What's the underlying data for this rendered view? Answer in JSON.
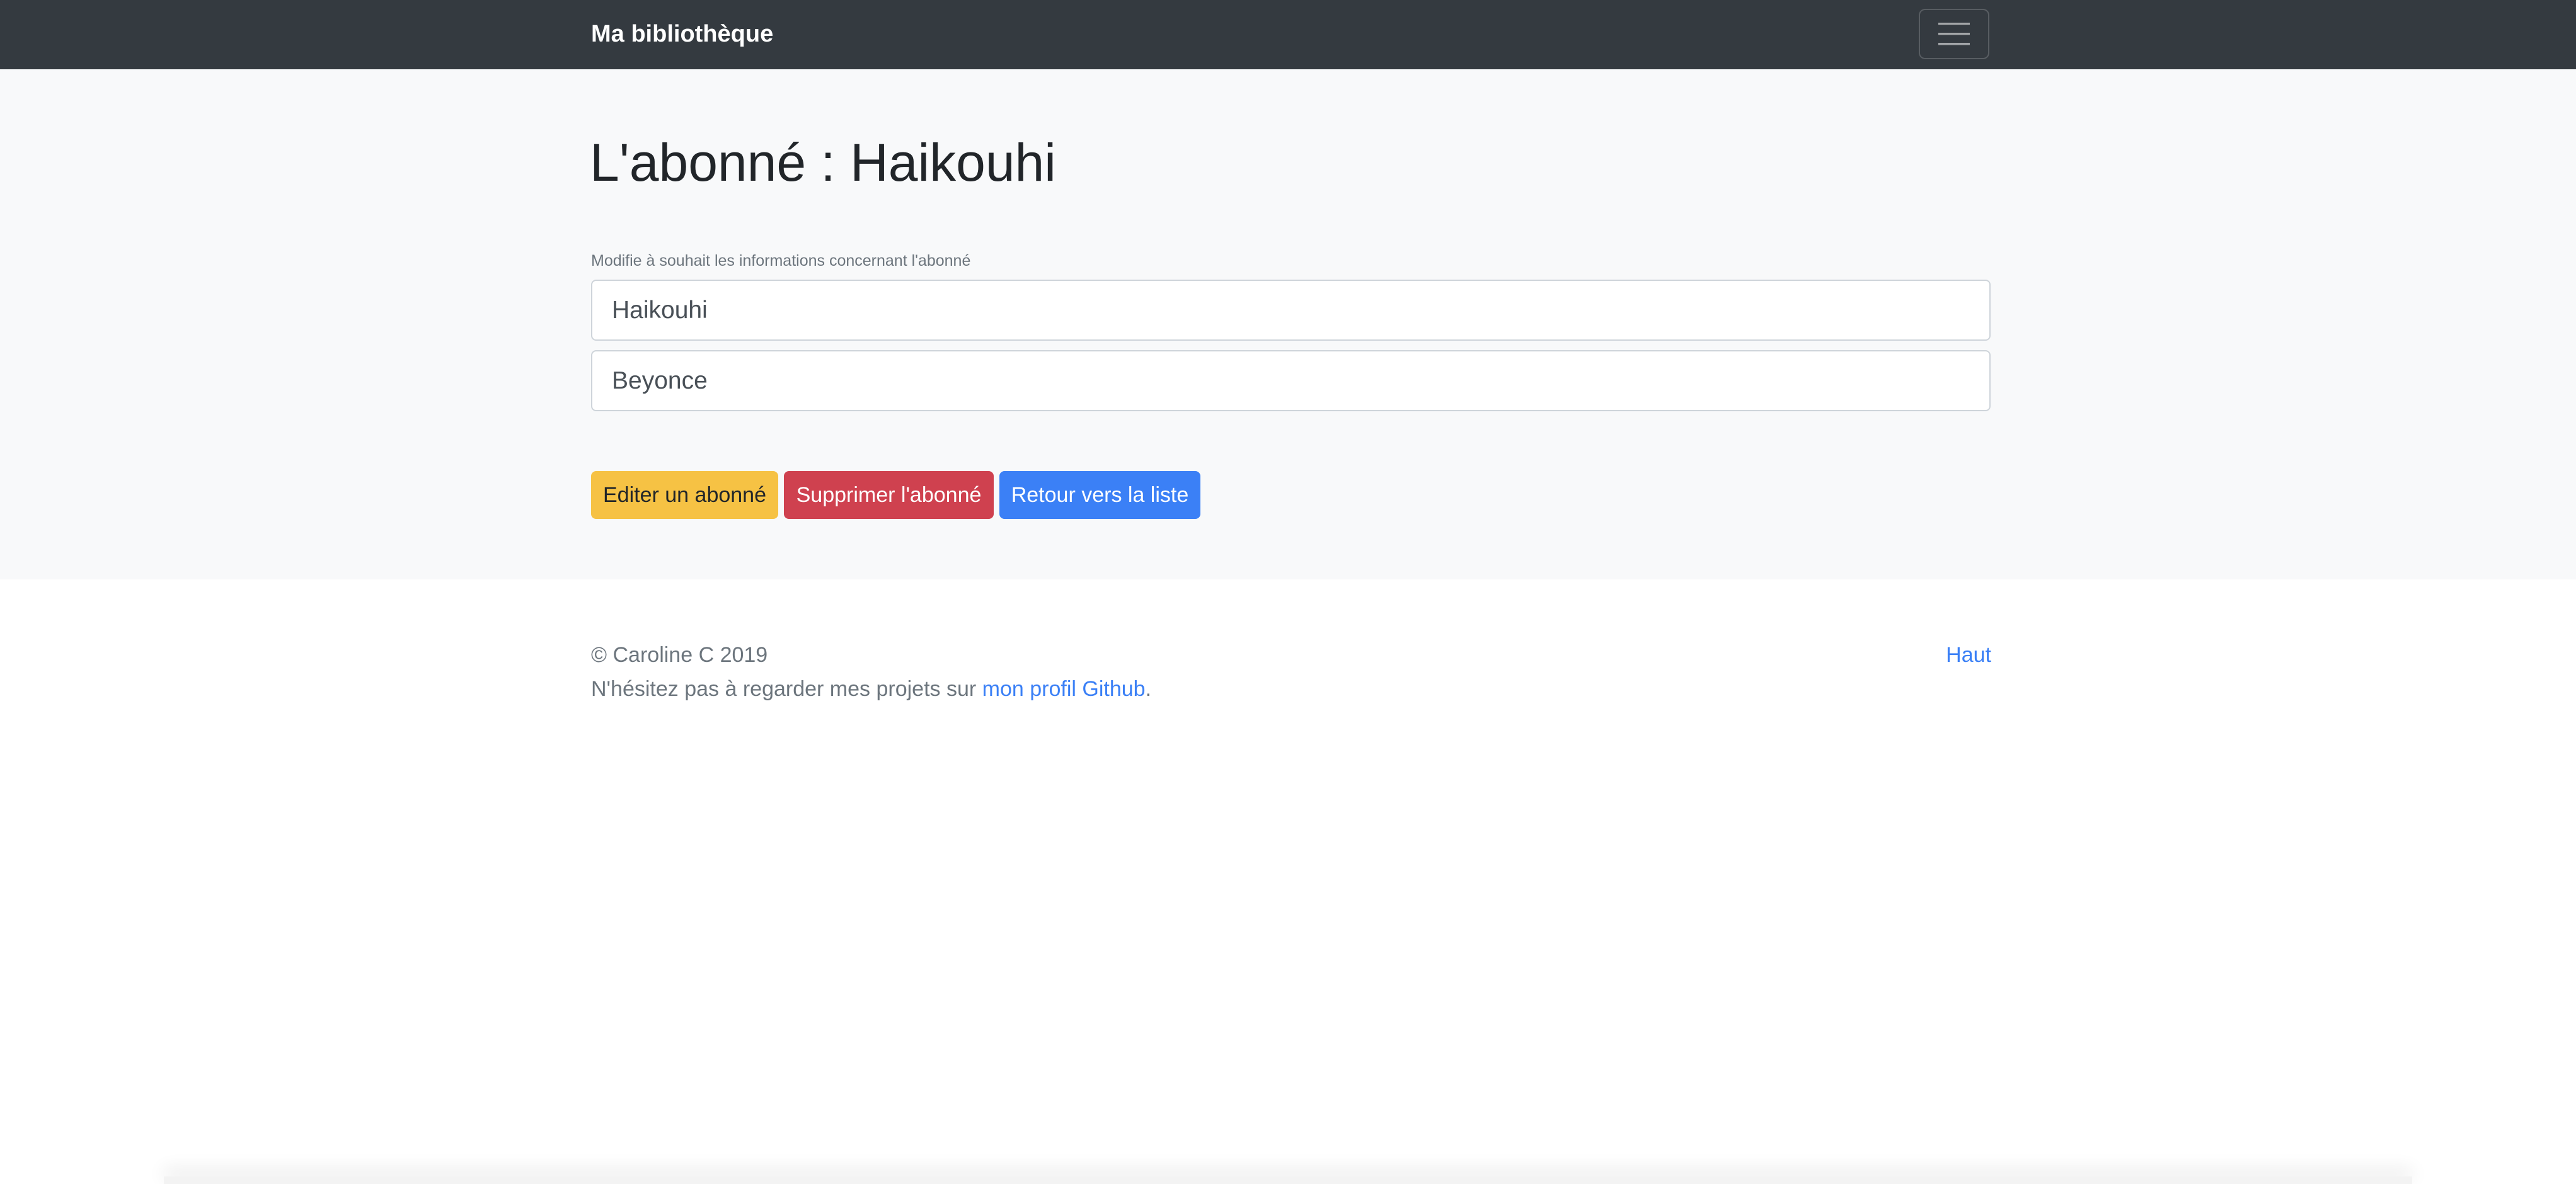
{
  "navbar": {
    "brand": "Ma bibliothèque",
    "toggler_icon": "hamburger-icon"
  },
  "main": {
    "title": "L'abonné : Haikouhi",
    "form_help": "Modifie à souhait les informations concernant l'abonné",
    "inputs": [
      {
        "value": "Haikouhi"
      },
      {
        "value": "Beyonce"
      }
    ],
    "buttons": {
      "edit": "Editer un abonné",
      "delete": "Supprimer l'abonné",
      "back": "Retour vers la liste"
    }
  },
  "footer": {
    "copyright": "© Caroline C 2019",
    "projects_text": "N'hésitez pas à regarder mes projets sur ",
    "github_link": "mon profil Github",
    "projects_end": ".",
    "top_link": "Haut"
  },
  "colors": {
    "navbar_bg": "#343a40",
    "main_bg": "#f8f9fa",
    "warning": "#f6c244",
    "danger": "#cf414f",
    "primary": "#3b80f6"
  }
}
